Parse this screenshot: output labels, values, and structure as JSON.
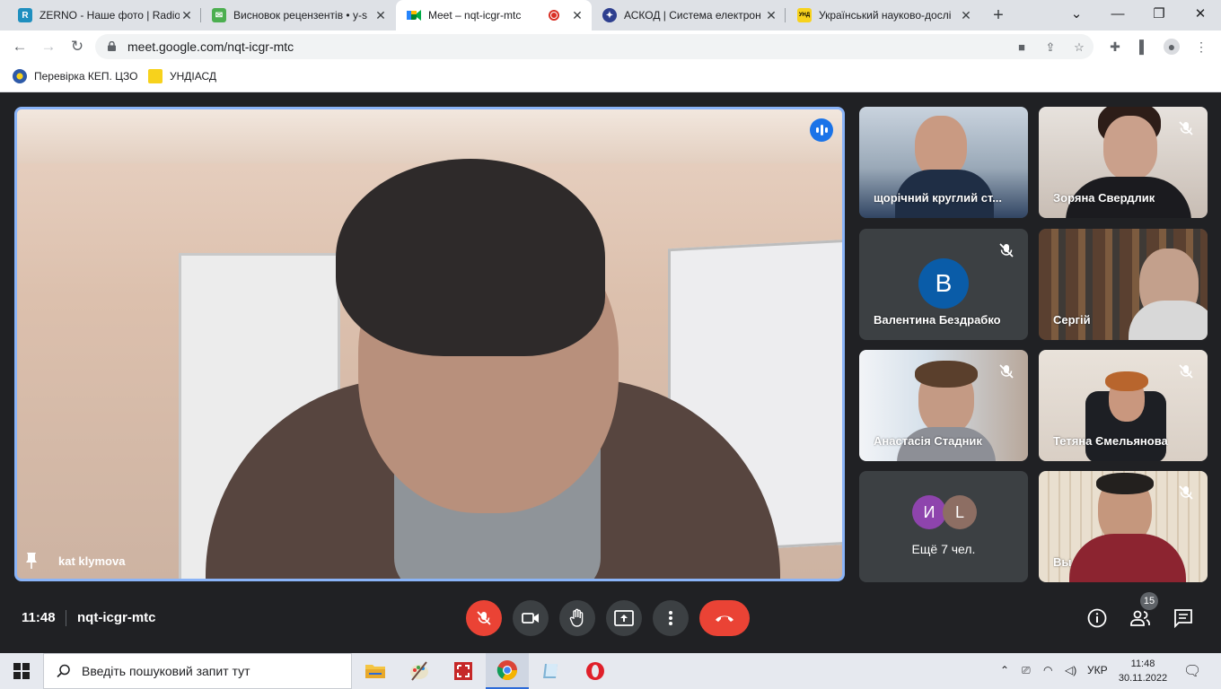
{
  "browser": {
    "tabs": [
      {
        "title": "ZERNO - Наше фото | Radio",
        "favicon_color": "#1f8fbf",
        "favicon_letter": "R"
      },
      {
        "title": "Висновок рецензентів • y-s",
        "favicon_color": "#4caf50",
        "favicon_letter": ""
      },
      {
        "title": "Meet – nqt-icgr-mtc",
        "favicon_color": "#00832d",
        "favicon_letter": ""
      },
      {
        "title": "АСКОД | Система електрон",
        "favicon_color": "#2e3f8f",
        "favicon_letter": ""
      },
      {
        "title": "Український науково-дослі",
        "favicon_color": "#f7d21c",
        "favicon_letter": "УНД"
      }
    ],
    "url": "meet.google.com/nqt-icgr-mtc",
    "bookmarks": [
      {
        "label": "Перевірка КЕП. ЦЗО"
      },
      {
        "label": "УНДІАСД"
      }
    ]
  },
  "meet": {
    "main_speaker": "kat klymova",
    "participants": [
      {
        "name": "щорічний круглий ст...",
        "muted": false
      },
      {
        "name": "Зоряна Свердлик",
        "muted": true
      },
      {
        "name": "Валентина Бездрабко",
        "muted": true,
        "avatar_letter": "В"
      },
      {
        "name": "Сергій",
        "muted": false
      },
      {
        "name": "Анастасія Стадник",
        "muted": true
      },
      {
        "name": "Тетяна Ємельянова",
        "muted": true
      },
      {
        "name": "Вы",
        "muted": true
      }
    ],
    "more": {
      "avatars": [
        {
          "letter": "И",
          "color": "#8e44ad"
        },
        {
          "letter": "L",
          "color": "#8d6e63"
        }
      ],
      "label": "Ещё 7 чел."
    },
    "time": "11:48",
    "meeting_code": "nqt-icgr-mtc",
    "people_count": "15"
  },
  "taskbar": {
    "search_placeholder": "Введіть пошуковий запит тут",
    "language": "УКР",
    "time": "11:48",
    "date": "30.11.2022"
  }
}
